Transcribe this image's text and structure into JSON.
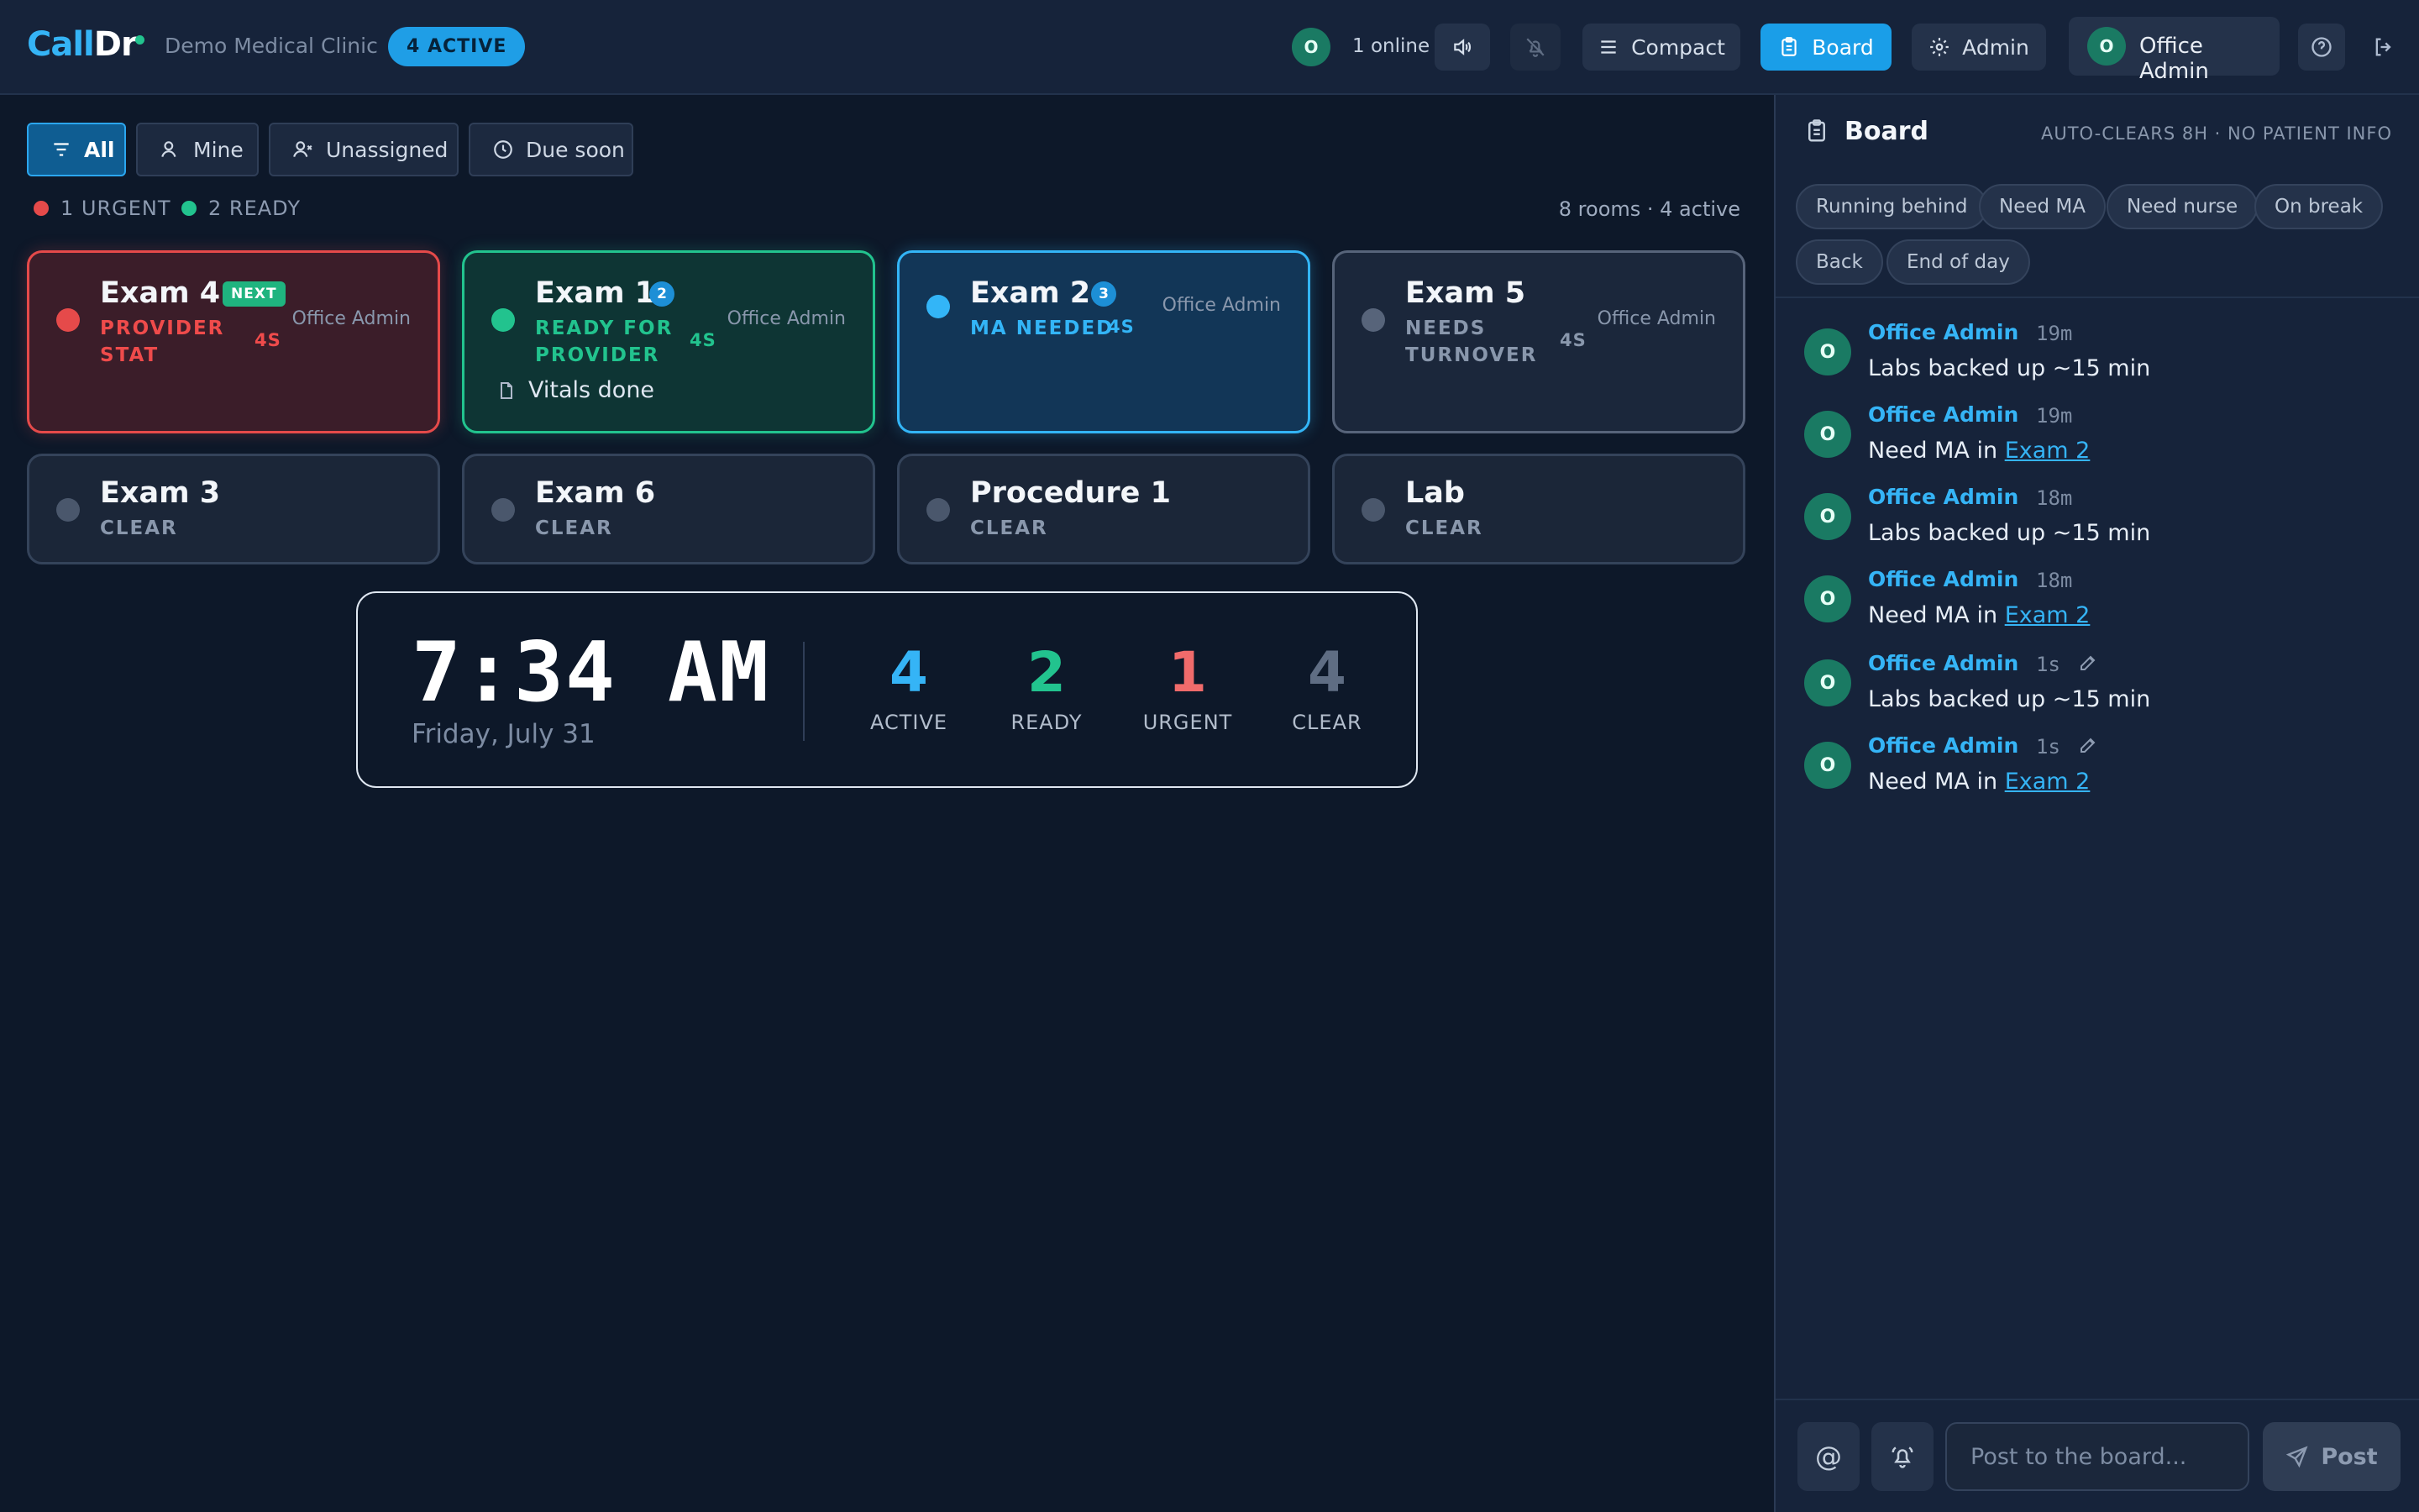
{
  "header": {
    "logo_a": "Call",
    "logo_b": "Dr",
    "clinic": "Demo Medical Clinic",
    "active_pill": "4 ACTIVE",
    "online_avatar": "O",
    "online_label": "1 online",
    "sound_icon": "speaker-icon",
    "mute_icon": "bell-off-icon",
    "compact_label": "Compact",
    "board_label": "Board",
    "admin_label": "Admin",
    "user_avatar": "O",
    "user_name": "Office Admin"
  },
  "filters": {
    "all": "All",
    "mine": "Mine",
    "unassigned": "Unassigned",
    "due_soon": "Due soon",
    "urgent_legend": "1 URGENT",
    "ready_legend": "2 READY",
    "summary": "8 rooms · 4 active"
  },
  "rooms": [
    {
      "name": "Exam 4",
      "badge": "NEXT",
      "status_line1": "PROVIDER",
      "status_line2": "STAT",
      "time": "4S",
      "user": "Office Admin"
    },
    {
      "name": "Exam 1",
      "badge": "2",
      "status_line1": "READY FOR",
      "status_line2": "PROVIDER",
      "time": "4S",
      "user": "Office Admin",
      "note": "Vitals done"
    },
    {
      "name": "Exam 2",
      "badge": "3",
      "status_line1": "MA NEEDED",
      "time": "4S",
      "user": "Office Admin"
    },
    {
      "name": "Exam 5",
      "status_line1": "NEEDS",
      "status_line2": "TURNOVER",
      "time": "4S",
      "user": "Office Admin"
    },
    {
      "name": "Exam 3",
      "status_line1": "CLEAR"
    },
    {
      "name": "Exam 6",
      "status_line1": "CLEAR"
    },
    {
      "name": "Procedure 1",
      "status_line1": "CLEAR"
    },
    {
      "name": "Lab",
      "status_line1": "CLEAR"
    }
  ],
  "clock": {
    "time": "7:34 AM",
    "date": "Friday, July 31",
    "stats": [
      {
        "value": "4",
        "label": "ACTIVE"
      },
      {
        "value": "2",
        "label": "READY"
      },
      {
        "value": "1",
        "label": "URGENT"
      },
      {
        "value": "4",
        "label": "CLEAR"
      }
    ]
  },
  "board": {
    "title": "Board",
    "note": "AUTO-CLEARS 8H · NO PATIENT INFO",
    "chips": [
      "Running behind",
      "Need MA",
      "Need nurse",
      "On break",
      "Back",
      "End of day"
    ],
    "messages": [
      {
        "avatar": "O",
        "author": "Office Admin",
        "time": "19m",
        "text": "Labs backed up ~15 min"
      },
      {
        "avatar": "O",
        "author": "Office Admin",
        "time": "19m",
        "text": "Need MA in ",
        "link": "Exam 2"
      },
      {
        "avatar": "O",
        "author": "Office Admin",
        "time": "18m",
        "text": "Labs backed up ~15 min"
      },
      {
        "avatar": "O",
        "author": "Office Admin",
        "time": "18m",
        "text": "Need MA in ",
        "link": "Exam 2"
      },
      {
        "avatar": "O",
        "author": "Office Admin",
        "time": "1s",
        "text": "Labs backed up ~15 min"
      },
      {
        "avatar": "O",
        "author": "Office Admin",
        "time": "1s",
        "text": "Need MA in ",
        "link": "Exam 2"
      }
    ],
    "composer_placeholder": "Post to the board...",
    "post_label": "Post",
    "at_symbol": "@"
  },
  "colors": {
    "accent": "#35b4f6",
    "urgent": "#e54a4a",
    "ready": "#22c38e",
    "clear": "#57647a",
    "background": "#0d1829"
  }
}
